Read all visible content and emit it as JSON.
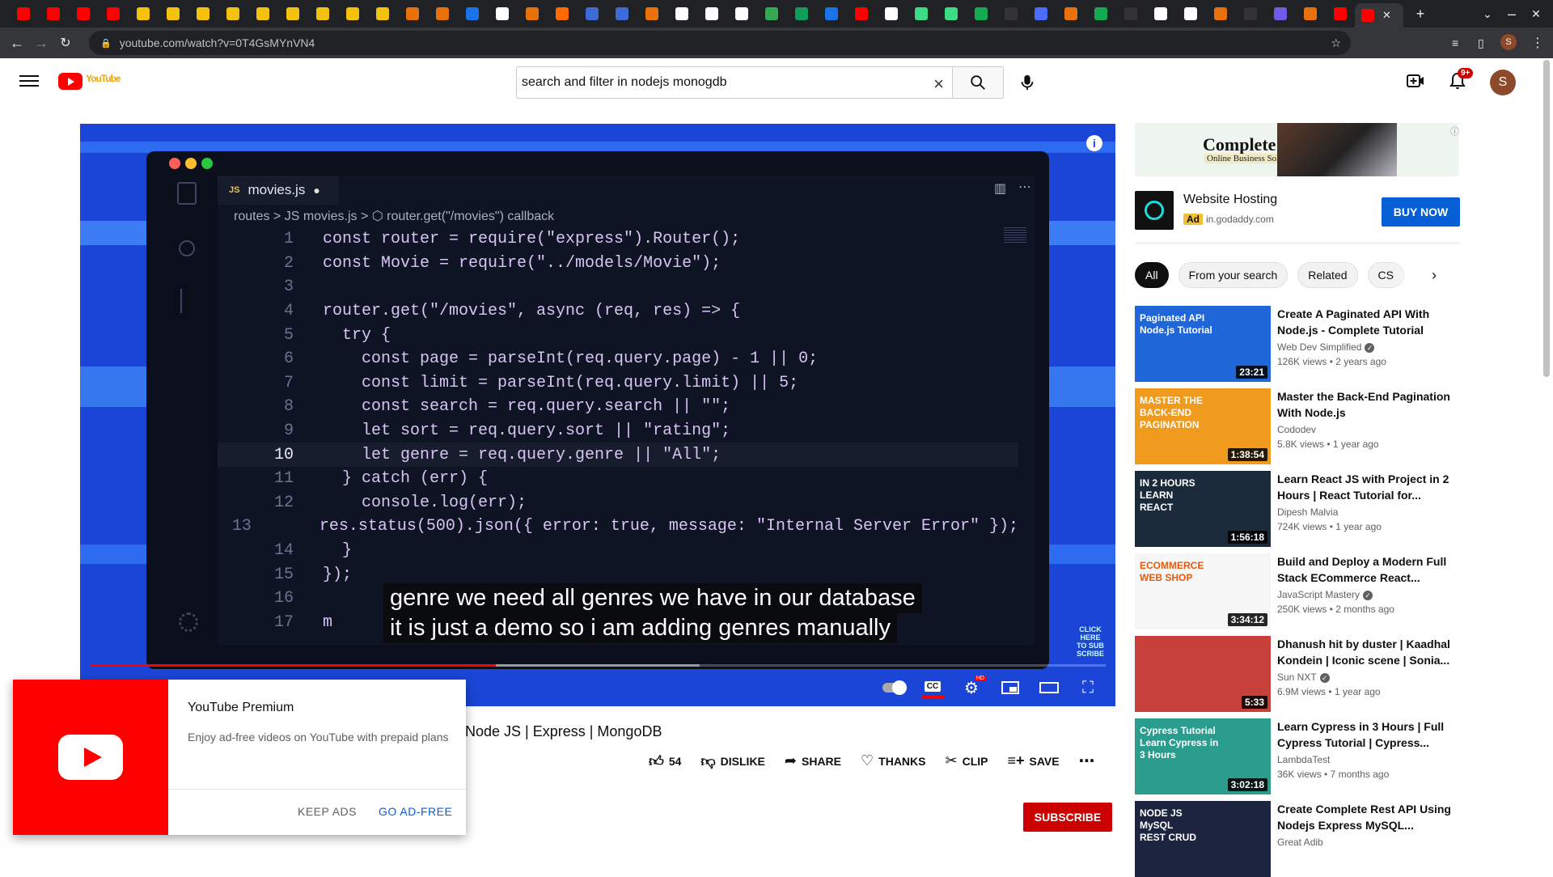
{
  "browser": {
    "url": "youtube.com/watch?v=0T4GsMYnVN4",
    "tab_favicon_colors": [
      "#ff0000",
      "#ff0000",
      "#ff0000",
      "#ff0000",
      "#f4c20d",
      "#f4c20d",
      "#f4c20d",
      "#f4c20d",
      "#f4c20d",
      "#f4c20d",
      "#f4c20d",
      "#f4c20d",
      "#f4c20d",
      "#e8710a",
      "#e8710a",
      "#1a73e8",
      "#ffffff",
      "#e8710a",
      "#ff6a00",
      "#3d6ad6",
      "#3d6ad6",
      "#e8710a",
      "#ffffff",
      "#ffffff",
      "#ffffff",
      "#34a853",
      "#0f9d58",
      "#1a73e8",
      "#ff0000",
      "#ffffff",
      "#3ddc84",
      "#3ddc84",
      "#13aa52",
      "#333333",
      "#4b6bfb",
      "#e8710a",
      "#13aa52",
      "#333333",
      "#ffffff",
      "#ffffff",
      "#e8710a",
      "#333333",
      "#6c5ce7",
      "#e8710a",
      "#ff0000"
    ],
    "new_tab_label": "+",
    "close_label": "✕"
  },
  "header": {
    "search_value": "search and filter in nodejs monogdb",
    "doodle_text": "YouTube",
    "notification_count": "9+",
    "avatar_initial": "S"
  },
  "player": {
    "editor_tab": "movies.js",
    "breadcrumb": "routes > JS movies.js > ⬡ router.get(\"/movies\") callback",
    "current_line": 10,
    "code_lines": [
      {
        "n": "1",
        "t": "const router = require(\"express\").Router();"
      },
      {
        "n": "2",
        "t": "const Movie = require(\"../models/Movie\");"
      },
      {
        "n": "3",
        "t": ""
      },
      {
        "n": "4",
        "t": "router.get(\"/movies\", async (req, res) => {"
      },
      {
        "n": "5",
        "t": "  try {"
      },
      {
        "n": "6",
        "t": "    const page = parseInt(req.query.page) - 1 || 0;"
      },
      {
        "n": "7",
        "t": "    const limit = parseInt(req.query.limit) || 5;"
      },
      {
        "n": "8",
        "t": "    const search = req.query.search || \"\";"
      },
      {
        "n": "9",
        "t": "    let sort = req.query.sort || \"rating\";"
      },
      {
        "n": "10",
        "t": "    let genre = req.query.genre || \"All\";"
      },
      {
        "n": "11",
        "t": "  } catch (err) {"
      },
      {
        "n": "12",
        "t": "    console.log(err);"
      },
      {
        "n": "13",
        "t": "    res.status(500).json({ error: true, message: \"Internal Server Error\" });"
      },
      {
        "n": "14",
        "t": "  }"
      },
      {
        "n": "15",
        "t": "});"
      },
      {
        "n": "16",
        "t": ""
      },
      {
        "n": "17",
        "t": "m"
      }
    ],
    "caption_line_1": "genre we need all genres we have in our database",
    "caption_line_2": "it is just a demo so i am adding genres manually",
    "progress": 0.4,
    "end_card_text": "CLICK HERE TO SUB SCRIBE"
  },
  "video": {
    "title_visible": "Node JS | Express | MongoDB",
    "likes": "54",
    "dislike_label": "DISLIKE",
    "share_label": "SHARE",
    "thanks_label": "THANKS",
    "clip_label": "CLIP",
    "save_label": "SAVE",
    "subscribe_label": "SUBSCRIBE"
  },
  "premium_popup": {
    "title": "YouTube Premium",
    "description": "Enjoy ad-free videos on YouTube with prepaid plans",
    "keep_ads": "KEEP ADS",
    "go_ad_free": "GO AD-FREE"
  },
  "sidebar": {
    "banner_title": "Complete",
    "banner_subtitle": "Online Business Solution",
    "ad_name": "Website Hosting",
    "ad_tag": "Ad",
    "ad_domain": "in.godaddy.com",
    "buy_now": "BUY NOW",
    "chips": [
      "All",
      "From your search",
      "Related",
      "CS"
    ],
    "recommendations": [
      {
        "title": "Create A Paginated API With Node.js - Complete Tutorial",
        "channel": "Web Dev Simplified",
        "verified": true,
        "meta": "126K views • 2 years ago",
        "duration": "23:21",
        "thumb_text": "Paginated API\nNode.js Tutorial",
        "thumb_color": "#1f66d8"
      },
      {
        "title": "Master the Back-End Pagination With Node.js",
        "channel": "Cododev",
        "verified": false,
        "meta": "5.8K views • 1 year ago",
        "duration": "1:38:54",
        "thumb_text": "MASTER THE\nBACK-END\nPAGINATION",
        "thumb_color": "#f09a1e"
      },
      {
        "title": "Learn React JS with Project in 2 Hours | React Tutorial for...",
        "channel": "Dipesh Malvia",
        "verified": false,
        "meta": "724K views • 1 year ago",
        "duration": "1:56:18",
        "thumb_text": "IN 2 HOURS\nLEARN\nREACT",
        "thumb_color": "#1b2a3a"
      },
      {
        "title": "Build and Deploy a Modern Full Stack ECommerce React...",
        "channel": "JavaScript Mastery",
        "verified": true,
        "meta": "250K views • 2 months ago",
        "duration": "3:34:12",
        "thumb_text": "ECOMMERCE\nWEB SHOP",
        "thumb_color": "#f6f6f6"
      },
      {
        "title": "Dhanush hit by duster | Kaadhal Kondein | Iconic scene | Sonia...",
        "channel": "Sun NXT",
        "verified": true,
        "meta": "6.9M views • 1 year ago",
        "duration": "5:33",
        "thumb_text": "",
        "thumb_color": "#c8403a"
      },
      {
        "title": "Learn Cypress in 3 Hours | Full Cypress Tutorial | Cypress...",
        "channel": "LambdaTest",
        "verified": false,
        "meta": "36K views • 7 months ago",
        "duration": "3:02:18",
        "thumb_text": "Cypress Tutorial\nLearn Cypress in\n3 Hours",
        "thumb_color": "#2a9d8f"
      },
      {
        "title": "Create Complete Rest API Using Nodejs Express MySQL...",
        "channel": "Great Adib",
        "verified": false,
        "meta": "",
        "duration": "",
        "thumb_text": "NODE JS\nMySQL\nREST CRUD",
        "thumb_color": "#1c2440"
      }
    ]
  }
}
